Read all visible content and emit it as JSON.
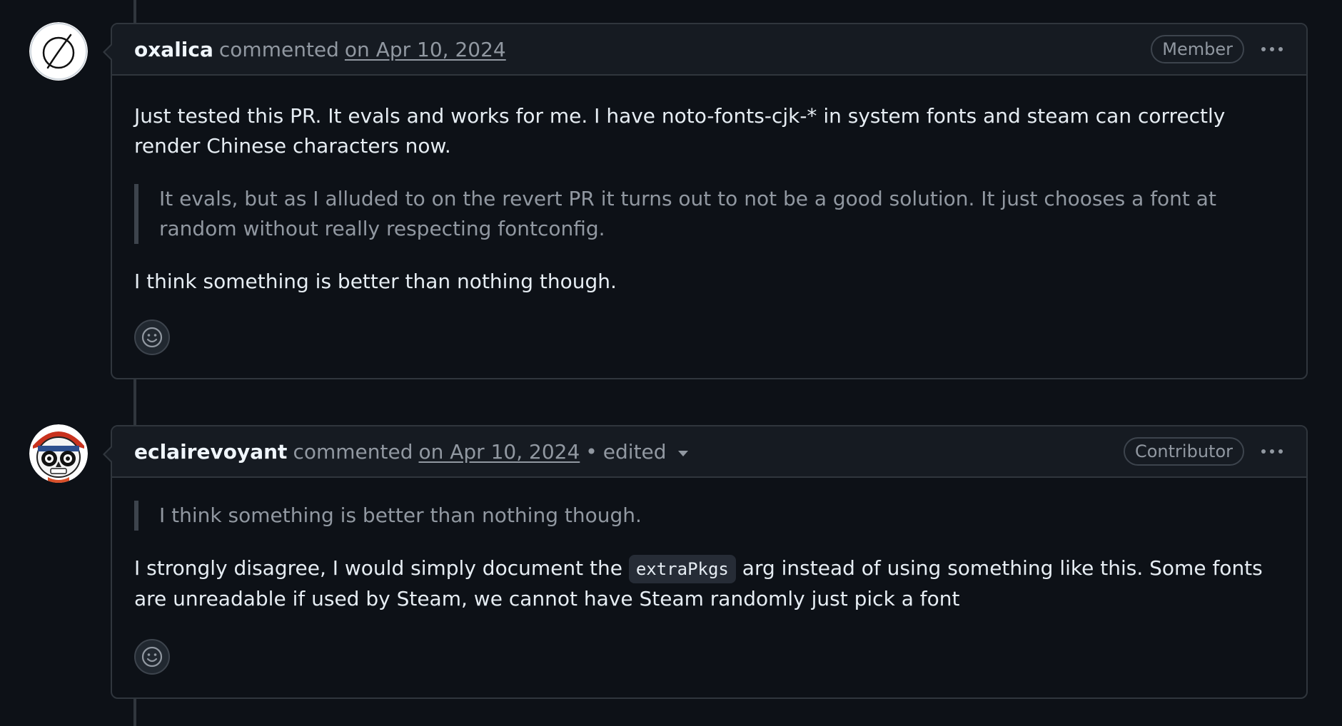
{
  "comments": [
    {
      "author": "oxalica",
      "verb": "commented",
      "date": "on Apr 10, 2024",
      "badge": "Member",
      "avatar_icon": "null-set-icon",
      "paragraph1": "Just tested this PR. It evals and works for me. I have noto-fonts-cjk-* in system fonts and steam can correctly render Chinese characters now.",
      "quote": "It evals, but as I alluded to on the revert PR it turns out to not be a good solution. It just chooses a font at random without really respecting fontconfig.",
      "paragraph2": "I think something is better than nothing though.",
      "reaction_icon": "smiley-icon"
    },
    {
      "author": "eclairevoyant",
      "verb": "commented",
      "date": "on Apr 10, 2024",
      "separator": "•",
      "edited": "edited",
      "badge": "Contributor",
      "avatar_icon": "sugar-skull-icon",
      "quote": "I think something is better than nothing though.",
      "text_before_code": "I strongly disagree, I would simply document the",
      "code": "extraPkgs",
      "text_after_code": "arg instead of using something like this. Some fonts are unreadable if used by Steam, we cannot have Steam randomly just pick a font",
      "reaction_icon": "smiley-icon"
    }
  ],
  "colors": {
    "background": "#0d1117",
    "header_background": "#161b22",
    "border": "#30363d",
    "text": "#e6edf3",
    "muted": "#9198a1"
  }
}
